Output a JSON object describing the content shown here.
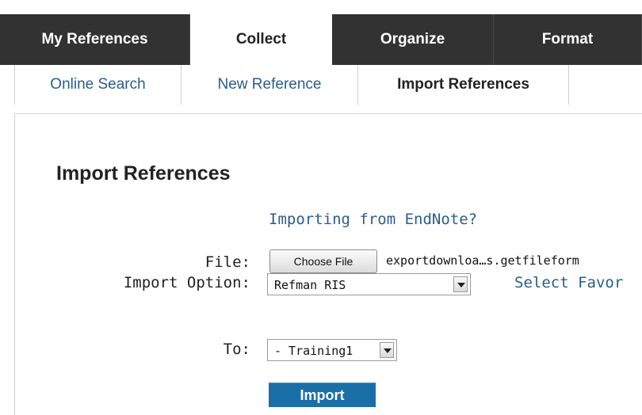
{
  "topnav": {
    "tabs": [
      {
        "label": "My References"
      },
      {
        "label": "Collect"
      },
      {
        "label": "Organize"
      },
      {
        "label": "Format"
      }
    ]
  },
  "subnav": {
    "items": [
      {
        "label": "Online Search"
      },
      {
        "label": "New Reference"
      },
      {
        "label": "Import References"
      }
    ]
  },
  "main": {
    "title": "Import References",
    "endnote_link": "Importing from EndNote?",
    "file_label": "File:",
    "choose_file_label": "Choose File",
    "file_name": "exportdownloa…s.getfileform",
    "import_option_label": "Import Option:",
    "import_option_value": "Refman RIS",
    "select_favorites": "Select Favor",
    "to_label": "To:",
    "to_value": "- Training1",
    "import_button": "Import"
  },
  "colors": {
    "tabbar": "#323232",
    "link": "#2a5d8a",
    "primary_button": "#1a6fa8"
  }
}
